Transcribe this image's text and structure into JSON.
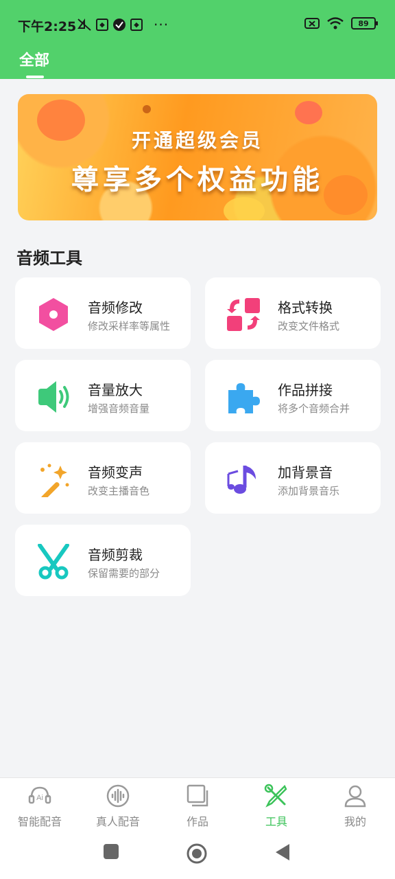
{
  "status_bar": {
    "time": "下午2:25",
    "battery": "89",
    "more": "···"
  },
  "top_tabs": {
    "active_label": "全部"
  },
  "banner": {
    "line1": "开通超级会员",
    "line2": "尊享多个权益功能"
  },
  "section": {
    "title": "音频工具"
  },
  "tools": [
    {
      "title": "音频修改",
      "subtitle": "修改采样率等属性",
      "icon": "hexagon-icon"
    },
    {
      "title": "格式转换",
      "subtitle": "改变文件格式",
      "icon": "convert-icon"
    },
    {
      "title": "音量放大",
      "subtitle": "增强音频音量",
      "icon": "speaker-icon"
    },
    {
      "title": "作品拼接",
      "subtitle": "将多个音频合并",
      "icon": "puzzle-icon"
    },
    {
      "title": "音频变声",
      "subtitle": "改变主播音色",
      "icon": "magic-wand-icon"
    },
    {
      "title": "加背景音",
      "subtitle": "添加背景音乐",
      "icon": "music-note-icon"
    },
    {
      "title": "音频剪裁",
      "subtitle": "保留需要的部分",
      "icon": "scissors-icon"
    }
  ],
  "bottom_nav": [
    {
      "label": "智能配音",
      "icon": "ai-voice-icon"
    },
    {
      "label": "真人配音",
      "icon": "waveform-icon"
    },
    {
      "label": "作品",
      "icon": "works-icon"
    },
    {
      "label": "工具",
      "icon": "tools-icon",
      "active": true
    },
    {
      "label": "我的",
      "icon": "person-icon"
    }
  ],
  "colors": {
    "brand": "#52d16b",
    "active_nav": "#3cc35a"
  }
}
